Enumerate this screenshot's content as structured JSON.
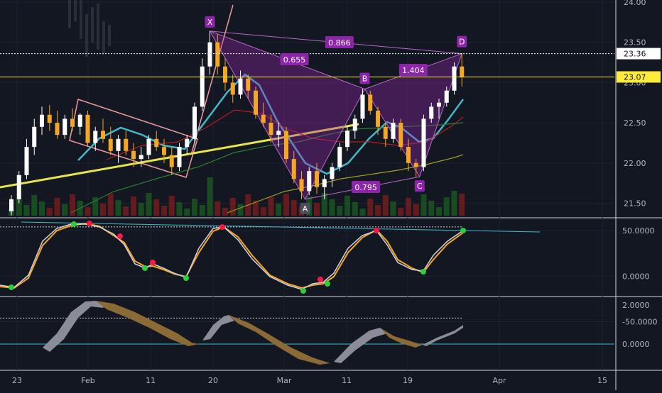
{
  "chart_data": [
    {
      "type": "candlestick",
      "panel": "price",
      "x_tick_labels": [
        "23",
        "Feb",
        "11",
        "20",
        "Mar",
        "11",
        "19",
        "Apr",
        "15"
      ],
      "y_tick_labels": [
        "24.00",
        "23.50",
        "23.00",
        "22.50",
        "22.00",
        "21.50"
      ],
      "ylim": [
        21.3,
        24.05
      ],
      "price_lines": [
        {
          "label": "23.36",
          "value": 23.36,
          "style": "dotted",
          "color": "#ffffff"
        },
        {
          "label": "23.07",
          "value": 23.07,
          "style": "solid",
          "color": "#ffeb3b"
        }
      ],
      "harmonic_pattern": {
        "points": [
          {
            "label": "X",
            "value": 23.64
          },
          {
            "label": "A",
            "value": 21.55
          },
          {
            "label": "B",
            "value": 22.92
          },
          {
            "label": "C",
            "value": 21.83
          },
          {
            "label": "D",
            "value": 23.36
          }
        ],
        "ratios": [
          "0.866",
          "0.655",
          "1.404",
          "0.795"
        ]
      },
      "series": [
        {
          "name": "",
          "kind": "moving-average",
          "color": "#42b8c8"
        },
        {
          "name": "",
          "kind": "moving-average",
          "color": "#b71c1c"
        },
        {
          "name": "",
          "kind": "moving-average",
          "color": "#2e7d32"
        },
        {
          "name": "",
          "kind": "moving-average",
          "color": "#9e9d24"
        }
      ],
      "candles": [
        [
          21.4,
          21.6,
          21.35,
          21.55
        ],
        [
          21.55,
          21.9,
          21.5,
          21.85
        ],
        [
          21.85,
          22.3,
          21.8,
          22.2
        ],
        [
          22.2,
          22.55,
          22.1,
          22.45
        ],
        [
          22.45,
          22.7,
          22.35,
          22.6
        ],
        [
          22.6,
          22.72,
          22.4,
          22.5
        ],
        [
          22.5,
          22.65,
          22.3,
          22.35
        ],
        [
          22.35,
          22.6,
          22.3,
          22.55
        ],
        [
          22.55,
          22.68,
          22.4,
          22.45
        ],
        [
          22.45,
          22.62,
          22.35,
          22.6
        ],
        [
          22.6,
          22.65,
          22.2,
          22.25
        ],
        [
          22.25,
          22.45,
          22.15,
          22.4
        ],
        [
          22.4,
          22.55,
          22.25,
          22.3
        ],
        [
          22.3,
          22.45,
          22.1,
          22.15
        ],
        [
          22.15,
          22.35,
          22.0,
          22.3
        ],
        [
          22.3,
          22.4,
          22.1,
          22.15
        ],
        [
          22.15,
          22.25,
          21.95,
          22.05
        ],
        [
          22.05,
          22.2,
          21.95,
          22.1
        ],
        [
          22.1,
          22.35,
          22.05,
          22.3
        ],
        [
          22.3,
          22.4,
          22.15,
          22.2
        ],
        [
          22.2,
          22.3,
          22.0,
          22.1
        ],
        [
          22.1,
          22.2,
          21.85,
          21.95
        ],
        [
          21.95,
          22.25,
          21.9,
          22.2
        ],
        [
          22.2,
          22.35,
          22.1,
          22.3
        ],
        [
          22.3,
          22.75,
          22.25,
          22.7
        ],
        [
          22.7,
          23.3,
          22.65,
          23.2
        ],
        [
          23.2,
          23.64,
          23.1,
          23.5
        ],
        [
          23.5,
          23.6,
          23.1,
          23.2
        ],
        [
          23.2,
          23.3,
          22.9,
          23.0
        ],
        [
          23.0,
          23.1,
          22.75,
          22.85
        ],
        [
          22.85,
          23.15,
          22.8,
          23.05
        ],
        [
          23.05,
          23.1,
          22.8,
          22.9
        ],
        [
          22.9,
          22.95,
          22.55,
          22.6
        ],
        [
          22.6,
          22.75,
          22.45,
          22.5
        ],
        [
          22.5,
          22.6,
          22.25,
          22.35
        ],
        [
          22.35,
          22.5,
          22.2,
          22.4
        ],
        [
          22.4,
          22.45,
          22.0,
          22.05
        ],
        [
          22.05,
          22.15,
          21.75,
          21.8
        ],
        [
          21.8,
          21.9,
          21.55,
          21.65
        ],
        [
          21.65,
          21.95,
          21.6,
          21.9
        ],
        [
          21.9,
          22.0,
          21.62,
          21.7
        ],
        [
          21.7,
          21.85,
          21.55,
          21.8
        ],
        [
          21.8,
          22.0,
          21.7,
          21.95
        ],
        [
          21.95,
          22.25,
          21.9,
          22.2
        ],
        [
          22.2,
          22.45,
          22.15,
          22.4
        ],
        [
          22.4,
          22.6,
          22.3,
          22.55
        ],
        [
          22.55,
          22.92,
          22.5,
          22.85
        ],
        [
          22.85,
          22.9,
          22.6,
          22.65
        ],
        [
          22.65,
          22.7,
          22.35,
          22.45
        ],
        [
          22.45,
          22.5,
          22.2,
          22.3
        ],
        [
          22.3,
          22.55,
          22.25,
          22.5
        ],
        [
          22.5,
          22.55,
          22.15,
          22.2
        ],
        [
          22.2,
          22.3,
          21.9,
          22.0
        ],
        [
          22.0,
          22.05,
          21.83,
          21.95
        ],
        [
          21.95,
          22.6,
          21.9,
          22.55
        ],
        [
          22.55,
          22.75,
          22.5,
          22.7
        ],
        [
          22.7,
          22.8,
          22.55,
          22.75
        ],
        [
          22.75,
          22.95,
          22.7,
          22.9
        ],
        [
          22.9,
          23.25,
          22.85,
          23.2
        ],
        [
          23.2,
          23.36,
          22.95,
          23.07
        ]
      ]
    },
    {
      "type": "line",
      "panel": "oscillator",
      "y_tick_labels": [
        "50.0000",
        "0.0000",
        "-50.0000"
      ],
      "ylim": [
        -62,
        62
      ],
      "levels": [
        54,
        -46
      ]
    },
    {
      "type": "area",
      "panel": "histogram",
      "y_tick_labels": [
        "2.0000",
        "0.0000"
      ],
      "ylim": [
        -0.5,
        2.3
      ]
    }
  ]
}
